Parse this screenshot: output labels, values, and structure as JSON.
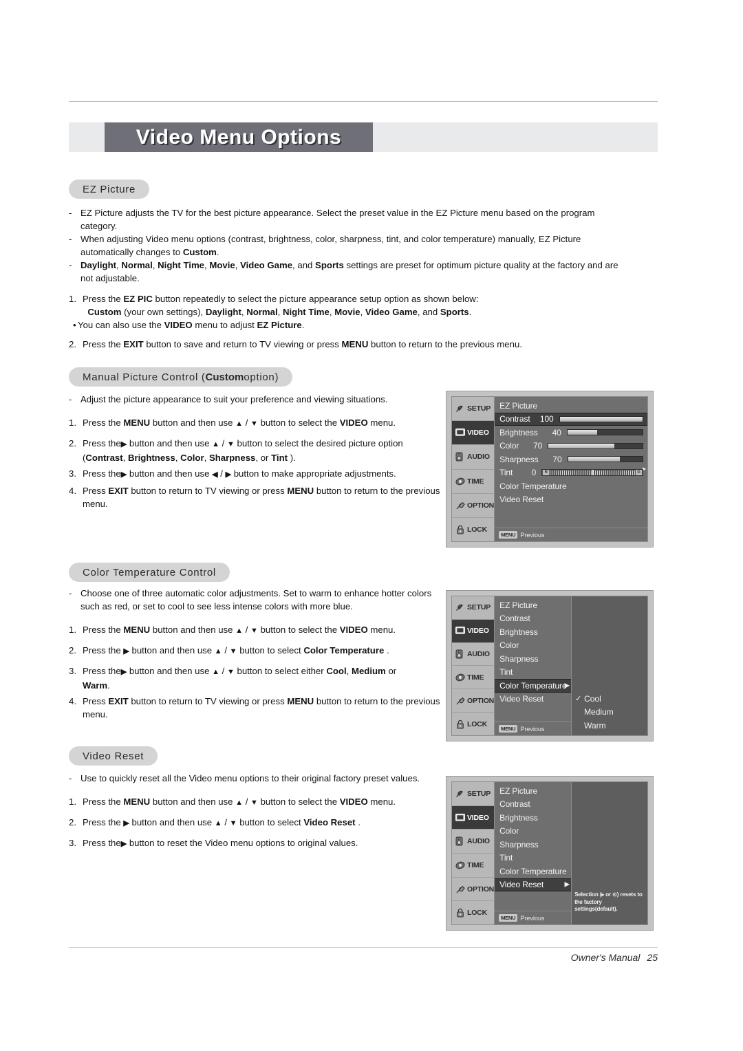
{
  "document": {
    "banner_title": "Video Menu Options",
    "footer_label": "Owner's Manual",
    "footer_page": "25"
  },
  "sections": {
    "ez_picture": {
      "pill": "EZ Picture",
      "bullets": [
        "EZ Picture adjusts the TV for the best picture appearance. Select the preset value in the EZ Picture menu based on the program category.",
        "When adjusting Video menu options (contrast, brightness, color, sharpness, tint, and color temperature) manually, EZ Picture automatically changes to Custom.",
        "Daylight, Normal, Night Time, Movie, Video Game, and Sports settings are preset for optimum picture quality at the factory and are not adjustable."
      ],
      "step1_a": "Press the EZ PIC button repeatedly to select the picture appearance setup option as shown below:",
      "step1_b": "Custom (your own settings), Daylight, Normal, Night Time, Movie, Video Game, and Sports.",
      "step1_note": "You can also use the VIDEO menu to adjust EZ Picture.",
      "step2": "Press the EXIT button to save and return to TV viewing or press MENU button to return to the previous menu."
    },
    "manual_picture": {
      "pill_prefix": "Manual Picture Control (",
      "pill_bold": "Custom",
      "pill_suffix": " option)",
      "bullet": "Adjust the picture appearance to suit your preference and viewing situations.",
      "step1": "Press the MENU button and then use ▲ / ▼ button to select the VIDEO menu.",
      "step2_a": "Press the ▶ button and then use ▲ / ▼ button to select the desired picture option",
      "step2_b": "(Contrast, Brightness, Color, Sharpness, or Tint ).",
      "step3": "Press the ▶ button and then use ◀ / ▶ button to make appropriate adjustments.",
      "step4": "Press EXIT button to return to TV viewing or press MENU button to return to the previous menu."
    },
    "color_temperature": {
      "pill": "Color Temperature Control",
      "bullet": "Choose one of three automatic color adjustments. Set to warm to enhance hotter colors such as red, or set to cool to see less intense colors with more blue.",
      "step1": "Press the MENU button and then use ▲ / ▼ button to select the VIDEO menu.",
      "step2": "Press the ▶ button and then use ▲ / ▼ button to select Color Temperature .",
      "step3_a": "Press the ▶ button and then use ▲ / ▼ button to select either Cool, Medium or",
      "step3_b": "Warm.",
      "step4": "Press EXIT button to return to TV viewing or press MENU button to return to the previous menu."
    },
    "video_reset": {
      "pill": "Video Reset",
      "bullet": "Use to quickly reset all the Video menu options to their original factory preset values.",
      "step1": "Press the MENU button and then use ▲ / ▼ button to select the VIDEO menu.",
      "step2": "Press the ▶ button and then use ▲ / ▼ button to select Video Reset .",
      "step3": "Press the ▶ button to reset the Video menu options to original values."
    }
  },
  "osd": {
    "sidebar": [
      {
        "label": "SETUP",
        "icon": "satellite-dish-icon",
        "active": false
      },
      {
        "label": "VIDEO",
        "icon": "monitor-icon",
        "active": true
      },
      {
        "label": "AUDIO",
        "icon": "speaker-icon",
        "active": false
      },
      {
        "label": "TIME",
        "icon": "clock-icon",
        "active": false
      },
      {
        "label": "OPTION",
        "icon": "wrench-icon",
        "active": false
      },
      {
        "label": "LOCK",
        "icon": "padlock-icon",
        "active": false
      }
    ],
    "previous_badge": "MENU",
    "previous_label": "Previous",
    "screen1": {
      "rows": [
        {
          "name": "EZ Picture",
          "value": "",
          "bar": "none",
          "pct": 0,
          "selected": false
        },
        {
          "name": "Contrast",
          "value": "100",
          "bar": "fill",
          "pct": 100,
          "selected": true
        },
        {
          "name": "Brightness",
          "value": "40",
          "bar": "fill",
          "pct": 40,
          "selected": false
        },
        {
          "name": "Color",
          "value": "70",
          "bar": "fill",
          "pct": 70,
          "selected": false
        },
        {
          "name": "Sharpness",
          "value": "70",
          "bar": "fill",
          "pct": 70,
          "selected": false
        },
        {
          "name": "Tint",
          "value": "0",
          "bar": "tint",
          "pct": 50,
          "selected": false
        },
        {
          "name": "Color Temperature",
          "value": "",
          "bar": "none",
          "pct": 0,
          "selected": false
        },
        {
          "name": "Video Reset",
          "value": "",
          "bar": "none",
          "pct": 0,
          "selected": false
        }
      ],
      "tint_left": "R",
      "tint_right": "G"
    },
    "screen2": {
      "rows": [
        {
          "name": "EZ Picture",
          "selected": false
        },
        {
          "name": "Contrast",
          "selected": false
        },
        {
          "name": "Brightness",
          "selected": false
        },
        {
          "name": "Color",
          "selected": false
        },
        {
          "name": "Sharpness",
          "selected": false
        },
        {
          "name": "Tint",
          "selected": false
        },
        {
          "name": "Color Temperature",
          "selected": true
        },
        {
          "name": "Video Reset",
          "selected": false
        }
      ],
      "submenu": [
        {
          "label": "Cool",
          "checked": true
        },
        {
          "label": "Medium",
          "checked": false
        },
        {
          "label": "Warm",
          "checked": false
        }
      ],
      "check_glyph": "✓",
      "arrow_glyph": "▶"
    },
    "screen3": {
      "rows": [
        {
          "name": "EZ Picture",
          "selected": false
        },
        {
          "name": "Contrast",
          "selected": false
        },
        {
          "name": "Brightness",
          "selected": false
        },
        {
          "name": "Color",
          "selected": false
        },
        {
          "name": "Sharpness",
          "selected": false
        },
        {
          "name": "Tint",
          "selected": false
        },
        {
          "name": "Color Temperature",
          "selected": false
        },
        {
          "name": "Video Reset",
          "selected": true
        }
      ],
      "tooltip": "Selection (▸ or ⊙) resets to the factory settings(default).",
      "arrow_glyph": "▶"
    }
  },
  "colors": {
    "banner_bg": "#6e6f77",
    "banner_strip": "#e8eaec",
    "pill_bg": "#d4d4d4",
    "osd_frame": "#c3c3c3",
    "osd_sidebar": "#b8b8b8",
    "osd_panel": "#6f6f6f",
    "osd_selected": "#3f3f3f",
    "osd_sub_panel": "#5e5e5e"
  }
}
